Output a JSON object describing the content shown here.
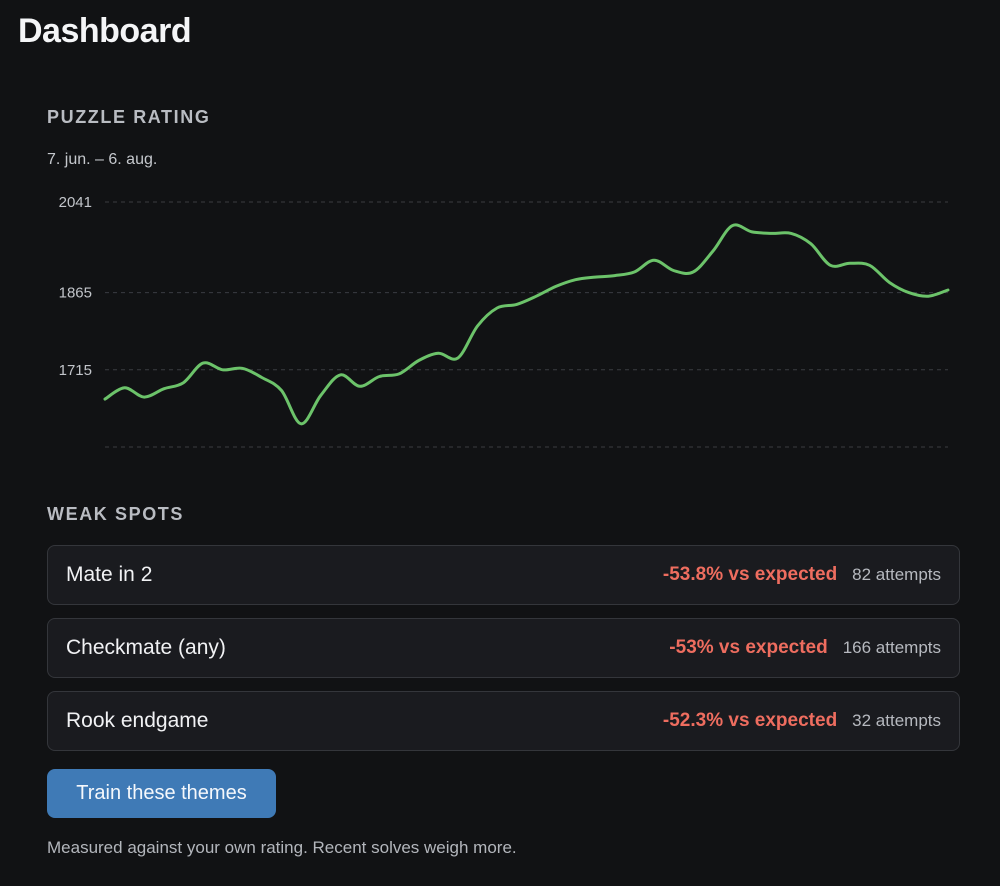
{
  "page": {
    "title": "Dashboard"
  },
  "rating": {
    "section_title": "PUZZLE RATING",
    "date_range": "7. jun. – 6. aug."
  },
  "chart_data": {
    "type": "line",
    "title": "",
    "xlabel": "",
    "ylabel": "",
    "y_ticks": [
      2041,
      1865,
      1715
    ],
    "ylim": [
      1565,
      2041
    ],
    "grid": true,
    "line_color": "#6cc36a",
    "series": [
      {
        "values": [
          1658,
          1680,
          1662,
          1678,
          1690,
          1728,
          1715,
          1718,
          1700,
          1675,
          1610,
          1665,
          1705,
          1683,
          1702,
          1707,
          1733,
          1747,
          1738,
          1800,
          1835,
          1842,
          1858,
          1877,
          1890,
          1895,
          1898,
          1905,
          1928,
          1908,
          1905,
          1945,
          1995,
          1983,
          1980,
          1980,
          1960,
          1918,
          1922,
          1918,
          1885,
          1865,
          1858,
          1870
        ]
      }
    ]
  },
  "weak_spots": {
    "section_title": "WEAK SPOTS",
    "items": [
      {
        "name": "Mate in 2",
        "delta": "-53.8% vs expected",
        "attempts": "82 attempts"
      },
      {
        "name": "Checkmate (any)",
        "delta": "-53% vs expected",
        "attempts": "166 attempts"
      },
      {
        "name": "Rook endgame",
        "delta": "-52.3% vs expected",
        "attempts": "32 attempts"
      }
    ],
    "train_button_label": "Train these themes",
    "footnote": "Measured against your own rating. Recent solves weigh more."
  }
}
